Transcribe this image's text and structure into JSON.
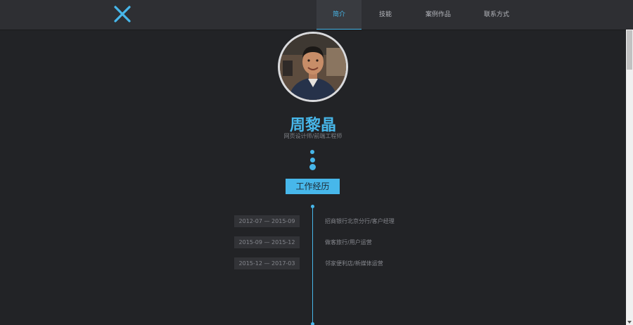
{
  "brand": {
    "logo_icon": "x-logo-icon",
    "accent_color": "#47b7ea"
  },
  "nav": {
    "items": [
      {
        "label": "简介",
        "active": true
      },
      {
        "label": "技能",
        "active": false
      },
      {
        "label": "案例作品",
        "active": false
      },
      {
        "label": "联系方式",
        "active": false
      }
    ]
  },
  "profile": {
    "avatar_icon": "profile-photo",
    "name": "周黎晶",
    "title": "网页设计师/前端工程师"
  },
  "section": {
    "label": "工作经历"
  },
  "timeline": [
    {
      "date": "2012-07 — 2015-09",
      "desc": "招商银行北京分行/客户经理"
    },
    {
      "date": "2015-09 — 2015-12",
      "desc": "做客旅行/用户运营"
    },
    {
      "date": "2015-12 — 2017-03",
      "desc": "邻家便利店/新媒体运营"
    }
  ]
}
